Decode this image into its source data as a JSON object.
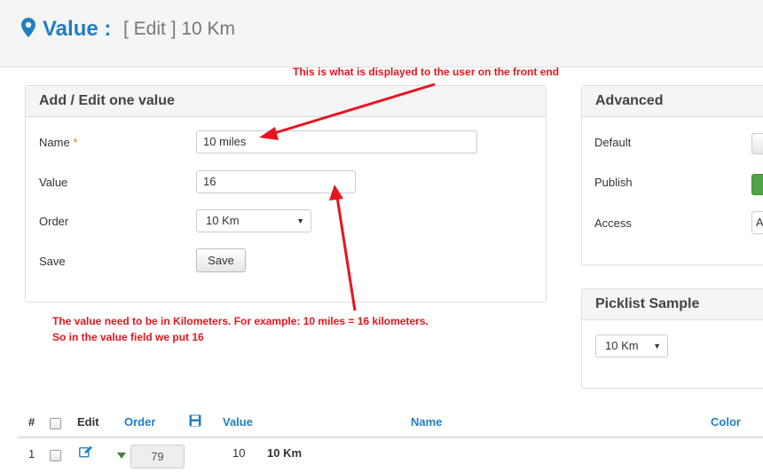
{
  "page_header": {
    "title": "Value :",
    "subtitle": "[ Edit ] 10 Km"
  },
  "annotations": {
    "front_end_note": "This is what is displayed to the user on the front end",
    "kilometers_note_line1": "The value need to be in Kilometers. For example:  10 miles = 16 kilometers.",
    "kilometers_note_line2": "So in the value field we put 16"
  },
  "edit_panel": {
    "heading": "Add / Edit one value",
    "name_label": "Name",
    "required_mark": "*",
    "name_value": "10 miles",
    "value_label": "Value",
    "value_value": "16",
    "order_label": "Order",
    "order_selected": "10 Km",
    "save_label": "Save",
    "save_button": "Save"
  },
  "advanced_panel": {
    "heading": "Advanced",
    "default_label": "Default",
    "publish_label": "Publish",
    "access_label": "Access",
    "access_value_partial": "A"
  },
  "picklist_panel": {
    "heading": "Picklist Sample",
    "selected": "10 Km"
  },
  "table": {
    "headers": {
      "num": "#",
      "edit": "Edit",
      "order": "Order",
      "value": "Value",
      "name": "Name",
      "color": "Color"
    },
    "rows": [
      {
        "num": "1",
        "order": "79",
        "value": "10",
        "name": "10 Km"
      }
    ]
  },
  "colors": {
    "accent_blue": "#1f7fc3",
    "annotation_red": "#e8141d",
    "publish_green": "#4fa446"
  },
  "icons": {
    "header": "map-pin-icon",
    "save_order": "floppy-disk-icon",
    "row_edit": "edit-pencil-icon",
    "row_order": "sort-down-caret-icon"
  }
}
